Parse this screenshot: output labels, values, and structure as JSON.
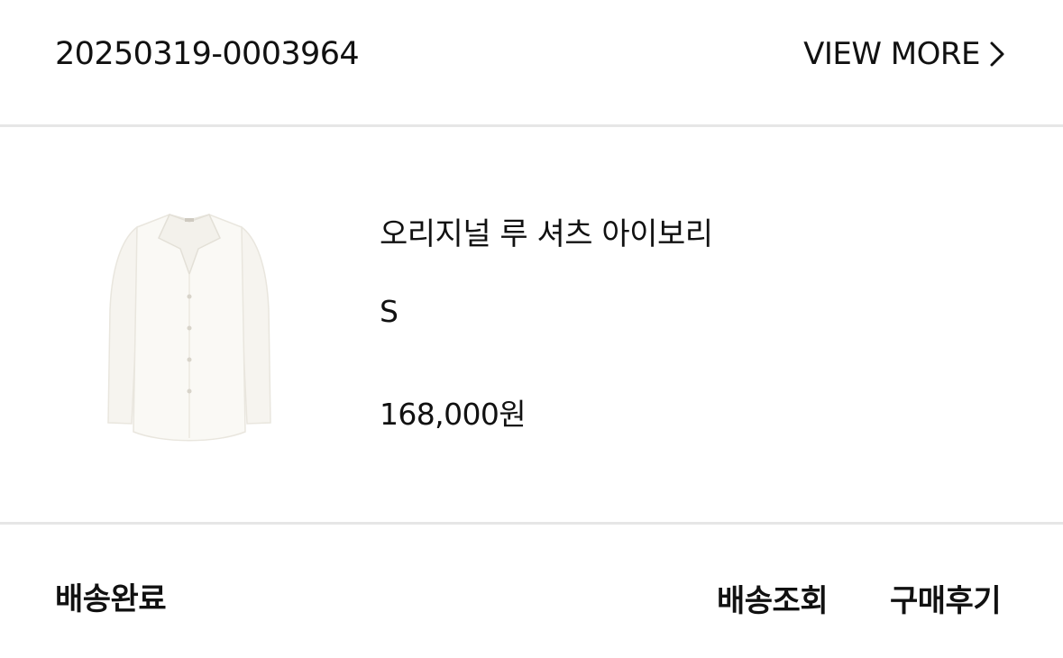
{
  "order": {
    "number": "20250319-0003964",
    "view_more_label": "VIEW MORE"
  },
  "item": {
    "image_icon": "white-shirt-product-image",
    "name": "오리지널 루 셔츠 아이보리",
    "option": "S",
    "price": "168,000원"
  },
  "footer": {
    "status": "배송완료",
    "track_label": "배송조회",
    "review_label": "구매후기"
  }
}
